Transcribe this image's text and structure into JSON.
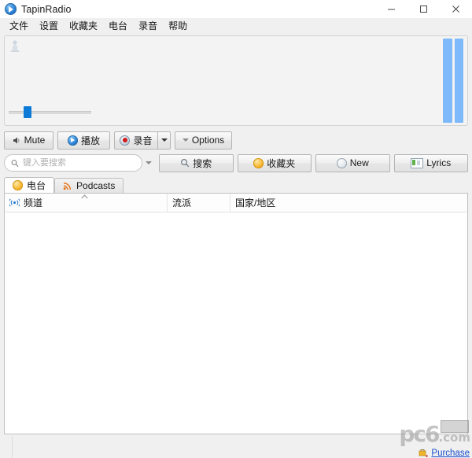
{
  "window": {
    "title": "TapinRadio",
    "app_icon": "play-circle-icon",
    "controls": {
      "minimize": "minimize-icon",
      "maximize": "maximize-icon",
      "close": "close-icon"
    }
  },
  "menubar": {
    "items": [
      {
        "label": "文件"
      },
      {
        "label": "设置"
      },
      {
        "label": "收藏夹"
      },
      {
        "label": "电台"
      },
      {
        "label": "录音"
      },
      {
        "label": "帮助"
      }
    ]
  },
  "player": {
    "status_icon": "radio-tower-icon",
    "vu_meter": {
      "icon": "vu-meter",
      "bars": 2,
      "color": "#7db9fb",
      "level_percent": 100
    },
    "volume": {
      "icon": "volume-slider",
      "value_percent": 18
    }
  },
  "transport": {
    "mute": {
      "label": "Mute",
      "icon": "speaker-mute-icon"
    },
    "play": {
      "label": "播放",
      "icon": "play-circle-icon"
    },
    "record": {
      "label": "录音",
      "icon": "record-circle-icon"
    },
    "record_dropdown": {
      "icon": "chevron-down-icon"
    },
    "options": {
      "label": "Options",
      "icon": "chevron-down-icon"
    }
  },
  "search": {
    "icon": "search-icon",
    "placeholder": "键入要搜索",
    "value": "",
    "dropdown_icon": "chevron-down-icon",
    "buttons": [
      {
        "label": "搜索",
        "icon": "search-icon",
        "name": "search-button"
      },
      {
        "label": "收藏夹",
        "icon": "star-circle-icon",
        "name": "favorites-button"
      },
      {
        "label": "New",
        "icon": "new-circle-icon",
        "name": "new-button"
      },
      {
        "label": "Lyrics",
        "icon": "lyrics-icon",
        "name": "lyrics-button"
      }
    ]
  },
  "tabs": [
    {
      "label": "电台",
      "icon": "radio-circle-icon",
      "active": true
    },
    {
      "label": "Podcasts",
      "icon": "rss-icon",
      "active": false
    }
  ],
  "list": {
    "columns": [
      {
        "label": "频道",
        "icon": "channel-icon",
        "sort_icon": "chevron-up-icon",
        "sorted": true
      },
      {
        "label": "流派",
        "icon": "",
        "sorted": false
      },
      {
        "label": "国家/地区",
        "icon": "",
        "sorted": false
      }
    ],
    "rows": []
  },
  "watermark": {
    "brand": "pc6",
    "domain": ".com",
    "purchase_label": "Purchase",
    "purchase_icon": "cart-icon"
  },
  "colors": {
    "accent_blue": "#0d7ad8",
    "vu_blue": "#7db9fb",
    "link_blue": "#1b4fcf",
    "window_bg": "#f0f0f0",
    "panel_bg": "#f3f3f3"
  }
}
